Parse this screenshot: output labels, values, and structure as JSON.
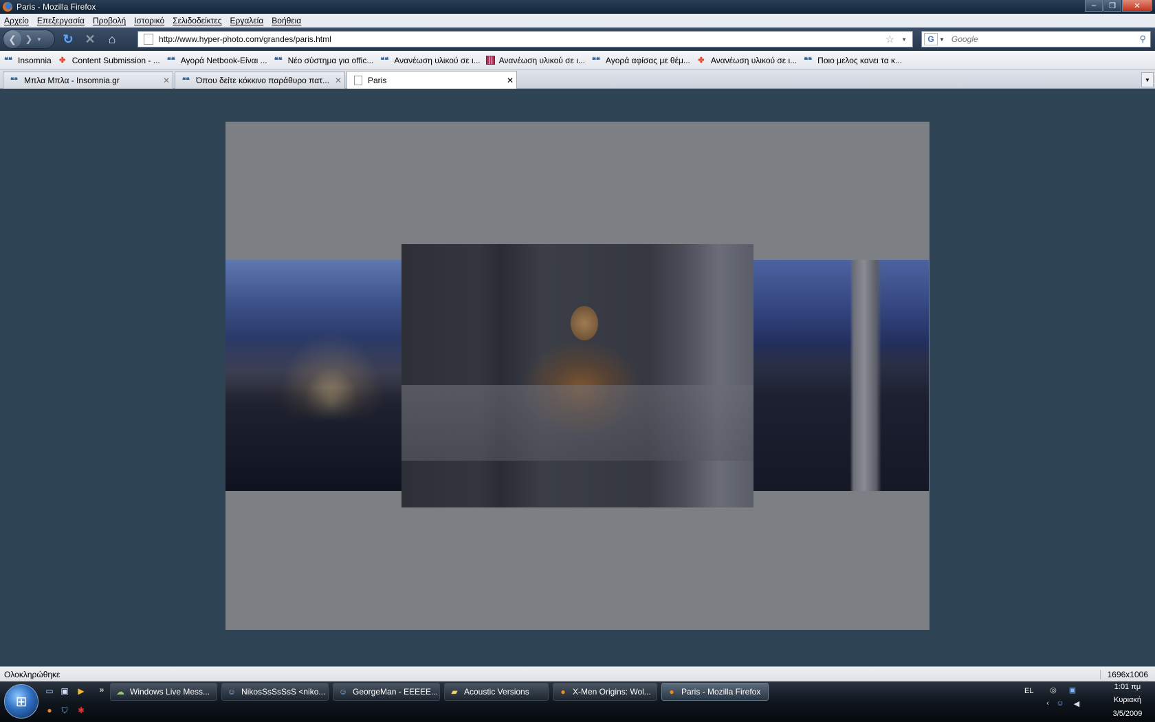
{
  "window": {
    "title": "Paris - Mozilla Firefox",
    "controls": {
      "minimize": "‒",
      "maximize": "❐",
      "close": "✕"
    }
  },
  "menu": [
    "Αρχείο",
    "Επεξεργασία",
    "Προβολή",
    "Ιστορικό",
    "Σελιδοδείκτες",
    "Εργαλεία",
    "Βοήθεια"
  ],
  "nav": {
    "url": "http://www.hyper-photo.com/grandes/paris.html",
    "search_placeholder": "Google",
    "search_engine_letter": "G"
  },
  "bookmarks": [
    {
      "label": "Insomnia",
      "icon": "insomnia-icon"
    },
    {
      "label": "Content Submission - ...",
      "icon": "joomla-icon"
    },
    {
      "label": "Αγορά Netbook-Είναι ...",
      "icon": "insomnia-icon"
    },
    {
      "label": "Νέο σύστημα για offic...",
      "icon": "insomnia-icon"
    },
    {
      "label": "Ανανέωση υλικού σε ι...",
      "icon": "insomnia-icon"
    },
    {
      "label": "Ανανέωση υλικού σε ι...",
      "icon": "grid-icon"
    },
    {
      "label": "Αγορά αφίσας με θέμ...",
      "icon": "insomnia-icon"
    },
    {
      "label": "Ανανέωση υλικού σε ι...",
      "icon": "joomla-icon"
    },
    {
      "label": "Ποιο μελος κανει τα κ...",
      "icon": "insomnia-icon"
    }
  ],
  "tabs": [
    {
      "label": "Μπλα Μπλα - Insomnia.gr",
      "active": false
    },
    {
      "label": "Όπου δείτε κόκκινο παράθυρο πατ...",
      "active": false
    },
    {
      "label": "Paris",
      "active": true
    }
  ],
  "status": {
    "text": "Ολοκληρώθηκε",
    "dimensions": "1696x1006"
  },
  "taskbar": {
    "buttons": [
      {
        "label": "Windows Live Mess...",
        "icon": "messenger-icon",
        "active": false
      },
      {
        "label": "NikosSsSsSsS <niko...",
        "icon": "messenger-chat-icon",
        "active": false
      },
      {
        "label": "GeorgeMan - EEEEE...",
        "icon": "messenger-chat-icon",
        "active": false
      },
      {
        "label": "Acoustic Versions",
        "icon": "folder-icon",
        "active": false
      },
      {
        "label": "X-Men Origins: Wol...",
        "icon": "firefox-icon",
        "active": false
      },
      {
        "label": "Paris - Mozilla Firefox",
        "icon": "firefox-icon",
        "active": true
      }
    ],
    "quicklaunch_more": "»",
    "tray": {
      "language": "EL",
      "time": "1:01 πμ",
      "day": "Κυριακή",
      "date": "3/5/2009"
    }
  },
  "colors": {
    "page_background": "#2f4455",
    "panel_background": "#7c7f84",
    "titlebar": "#1a2d44"
  }
}
